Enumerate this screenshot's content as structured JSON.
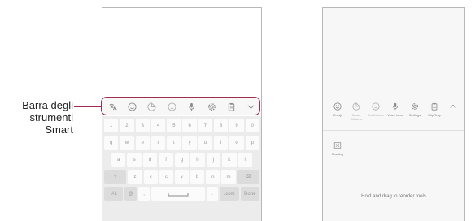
{
  "callout": {
    "line1": "Barra degli",
    "line2": "strumenti",
    "line3": "Smart"
  },
  "accent_color": "#a02c4e",
  "keyboard_toolbar": [
    {
      "icon": "translate-icon"
    },
    {
      "icon": "emoji-icon"
    },
    {
      "icon": "sticker-icon"
    },
    {
      "icon": "gif-icon"
    },
    {
      "icon": "microphone-icon"
    },
    {
      "icon": "settings-gear-icon"
    },
    {
      "icon": "clipboard-icon"
    },
    {
      "icon": "chevron-down-icon"
    }
  ],
  "keyboard_rows": [
    [
      "1",
      "2",
      "3",
      "4",
      "5",
      "6",
      "7",
      "8",
      "9",
      "0"
    ],
    [
      "q",
      "w",
      "e",
      "r",
      "t",
      "y",
      "u",
      "i",
      "o",
      "p"
    ],
    [
      "a",
      "s",
      "d",
      "f",
      "g",
      "h",
      "j",
      "k",
      "l"
    ],
    [
      "⇧",
      "z",
      "x",
      "c",
      "v",
      "b",
      "n",
      "m",
      "⌫"
    ],
    [
      "!#1",
      "@",
      ",",
      "space",
      ".",
      ".com",
      "Done"
    ]
  ],
  "edit_tools": [
    {
      "icon": "emoji-icon",
      "label": "Emoji"
    },
    {
      "icon": "sticker-icon",
      "label": "Smart Stickers"
    },
    {
      "icon": "gif-icon",
      "label": "AniMoticon"
    },
    {
      "icon": "microphone-icon",
      "label": "Voice input"
    },
    {
      "icon": "settings-gear-icon",
      "label": "Settings"
    },
    {
      "icon": "clipboard-icon",
      "label": "Clip Tray"
    },
    {
      "icon": "chevron-up-icon",
      "label": ""
    }
  ],
  "floating_tool": {
    "icon": "floating-icon",
    "label": "Floating"
  },
  "hint": "Hold and drag to reorder tools"
}
